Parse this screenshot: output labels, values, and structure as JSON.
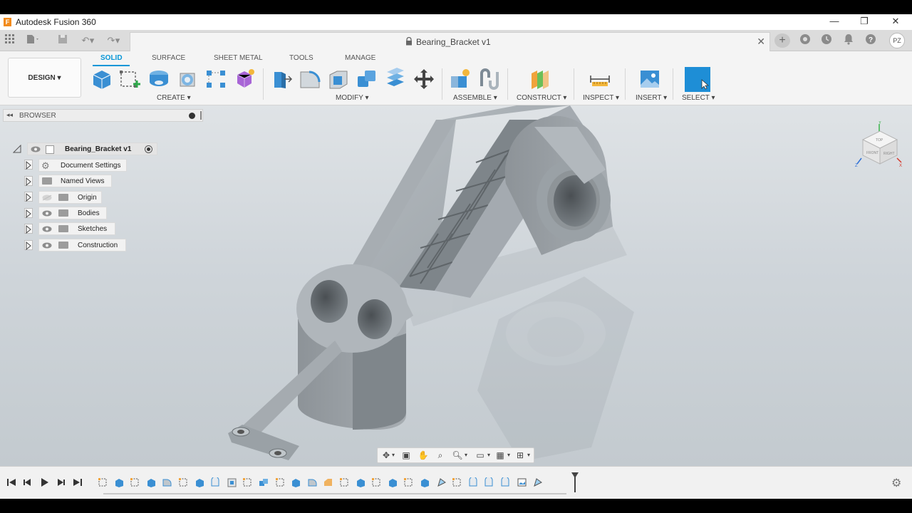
{
  "window": {
    "app_title": "Autodesk Fusion 360",
    "logo_letter": "F",
    "minimize": "—",
    "maximize": "❐",
    "close": "✕"
  },
  "document_tab": {
    "title": "Bearing_Bracket v1",
    "close": "✕"
  },
  "user": {
    "initials": "PZ"
  },
  "workspace": {
    "label": "DESIGN ▾"
  },
  "ribbon_tabs": [
    {
      "label": "SOLID",
      "active": true
    },
    {
      "label": "SURFACE"
    },
    {
      "label": "SHEET METAL"
    },
    {
      "label": "TOOLS"
    },
    {
      "label": "MANAGE"
    }
  ],
  "tool_groups": [
    {
      "label": "CREATE ▾"
    },
    {
      "label": "MODIFY ▾"
    },
    {
      "label": "ASSEMBLE ▾"
    },
    {
      "label": "CONSTRUCT ▾"
    },
    {
      "label": "INSPECT ▾"
    },
    {
      "label": "INSERT ▾"
    },
    {
      "label": "SELECT ▾"
    }
  ],
  "browser": {
    "header": "BROWSER",
    "root": "Bearing_Bracket v1",
    "items": [
      {
        "label": "Document Settings"
      },
      {
        "label": "Named Views"
      },
      {
        "label": "Origin"
      },
      {
        "label": "Bodies"
      },
      {
        "label": "Sketches"
      },
      {
        "label": "Construction"
      }
    ]
  },
  "viewcube": {
    "top": "TOP",
    "front": "FRONT",
    "right": "RIGHT",
    "axis_x": "X",
    "axis_y": "Y",
    "axis_z": "Z"
  },
  "colors": {
    "accent": "#0696d7",
    "part": "#9aa1a6",
    "viewport_top": "#dfe3e6",
    "viewport_bottom": "#c3cacf"
  }
}
